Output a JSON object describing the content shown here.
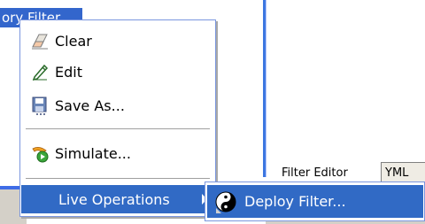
{
  "background": {
    "selected_tab_label": "ory Filter",
    "filter_editor_label": "Filter Editor",
    "yml_tab_label": "YML"
  },
  "context_menu": {
    "items": [
      {
        "label": "Clear",
        "icon": "eraser-icon"
      },
      {
        "label": "Edit",
        "icon": "pencil-icon"
      },
      {
        "label": "Save As...",
        "icon": "floppy-disk-icon"
      },
      {
        "label": "Simulate...",
        "icon": "simulate-icon"
      },
      {
        "label": "Live Operations",
        "icon": "",
        "has_submenu": true,
        "highlighted": true
      }
    ]
  },
  "submenu": {
    "items": [
      {
        "label": "Deploy Filter...",
        "icon": "deploy-yin-yang-icon",
        "highlighted": true
      }
    ]
  },
  "colors": {
    "highlight": "#316ac5",
    "menu_border": "#7a96df",
    "splitter": "#3d77e0"
  }
}
